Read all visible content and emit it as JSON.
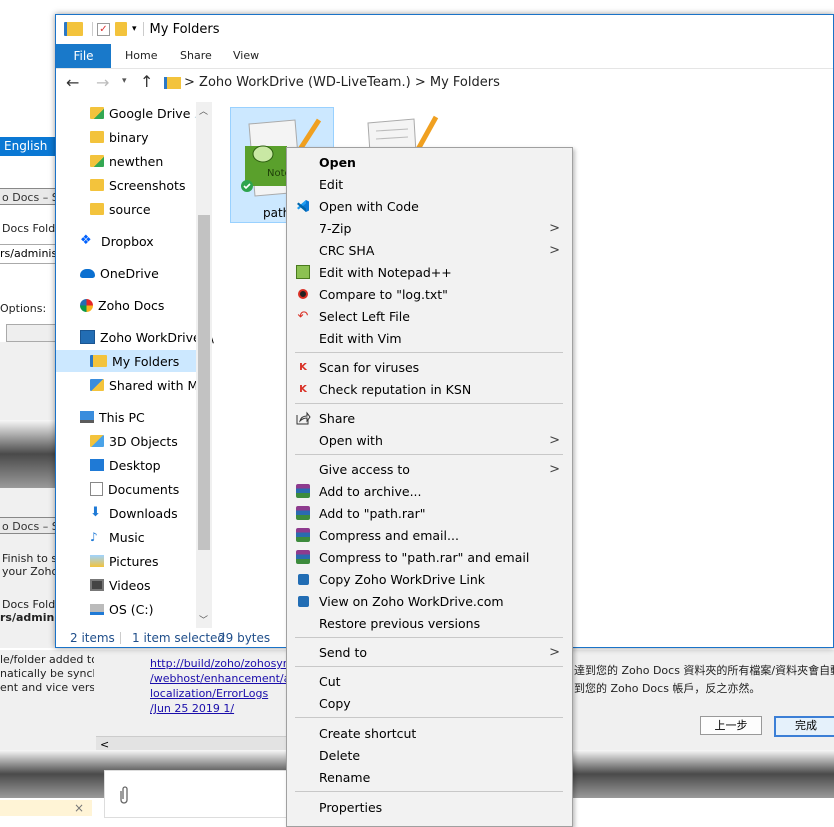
{
  "background": {
    "language_label": "English",
    "titles": [
      "o Docs – Si",
      "o Docs – Si"
    ],
    "folder_labels": [
      "Docs Folde",
      "Docs Folde"
    ],
    "path_values": [
      "rs/adminis",
      "rs/adminis"
    ],
    "options_label": "Options:",
    "finish_text": [
      "Finish to st",
      "your Zoho"
    ],
    "sync_text": [
      "le/folder added to",
      "natically be synchr",
      "ent and vice versa."
    ],
    "log_links": [
      "http://build/zoho/zohosync",
      "/webhost/enhancement/age",
      "localization/ErrorLogs",
      "/Jun 25 2019 1/"
    ],
    "chinese_lines": [
      "達到您的 Zoho Docs 資料夾的所有檔案/資料夾會自動同",
      "到您的 Zoho Docs 帳戶，反之亦然。"
    ],
    "prev_button": "上一步",
    "done_button": "完成",
    "scroll_left": "<",
    "attach_icon": "paperclip-icon",
    "close_glyph": "×"
  },
  "explorer": {
    "title": "My Folders",
    "ribbon_tabs": [
      "File",
      "Home",
      "Share",
      "View"
    ],
    "address": {
      "segments": [
        "Zoho WorkDrive (WD-LiveTeam.)",
        "My Folders"
      ],
      "separator": ">"
    },
    "nav_items": [
      {
        "label": "Google Drive",
        "icon": "google-drive-folder-icon",
        "pinned": true
      },
      {
        "label": "binary",
        "icon": "folder-icon"
      },
      {
        "label": "newthen",
        "icon": "folder-icon"
      },
      {
        "label": "Screenshots",
        "icon": "folder-icon"
      },
      {
        "label": "source",
        "icon": "folder-icon"
      },
      {
        "label": "Dropbox",
        "icon": "dropbox-icon"
      },
      {
        "label": "OneDrive",
        "icon": "onedrive-icon"
      },
      {
        "label": "Zoho Docs",
        "icon": "zoho-docs-icon"
      },
      {
        "label": "Zoho WorkDrive (\\",
        "icon": "zoho-workdrive-icon"
      },
      {
        "label": "My Folders",
        "icon": "my-folders-icon"
      },
      {
        "label": "Shared with Me",
        "icon": "shared-folder-icon"
      },
      {
        "label": "This PC",
        "icon": "this-pc-icon"
      },
      {
        "label": "3D Objects",
        "icon": "3d-objects-icon"
      },
      {
        "label": "Desktop",
        "icon": "desktop-folder-icon"
      },
      {
        "label": "Documents",
        "icon": "documents-folder-icon"
      },
      {
        "label": "Downloads",
        "icon": "downloads-folder-icon"
      },
      {
        "label": "Music",
        "icon": "music-folder-icon"
      },
      {
        "label": "Pictures",
        "icon": "pictures-folder-icon"
      },
      {
        "label": "Videos",
        "icon": "videos-folder-icon"
      },
      {
        "label": "OS (C:)",
        "icon": "drive-icon"
      }
    ],
    "files": [
      {
        "name": "path",
        "icon": "notepad-plus-plus-file-icon",
        "selected": true
      },
      {
        "name": "",
        "icon": "text-file-icon",
        "selected": false
      }
    ],
    "status": {
      "items": "2 items",
      "selected": "1 item selected",
      "size": "29 bytes"
    }
  },
  "context_menu": {
    "items": [
      {
        "label": "Open",
        "bold": true,
        "icon": ""
      },
      {
        "label": "Edit",
        "icon": ""
      },
      {
        "label": "Open with Code",
        "icon": "vscode-icon"
      },
      {
        "label": "7-Zip",
        "icon": "",
        "submenu": true
      },
      {
        "label": "CRC SHA",
        "icon": "",
        "submenu": true
      },
      {
        "label": "Edit with Notepad++",
        "icon": "notepad-plus-plus-icon"
      },
      {
        "label": "Compare to \"log.txt\"",
        "icon": "compare-icon"
      },
      {
        "label": "Select Left File",
        "icon": "undo-arrow-icon"
      },
      {
        "label": "Edit with Vim",
        "icon": ""
      },
      {
        "label": "Scan for viruses",
        "icon": "kaspersky-icon",
        "sep_before": true
      },
      {
        "label": "Check reputation in KSN",
        "icon": "kaspersky-icon"
      },
      {
        "label": "Share",
        "icon": "share-icon",
        "sep_before": true
      },
      {
        "label": "Open with",
        "icon": "",
        "submenu": true
      },
      {
        "label": "Give access to",
        "icon": "",
        "submenu": true,
        "sep_before": true
      },
      {
        "label": "Add to archive...",
        "icon": "winrar-icon"
      },
      {
        "label": "Add to \"path.rar\"",
        "icon": "winrar-icon"
      },
      {
        "label": "Compress and email...",
        "icon": "winrar-icon"
      },
      {
        "label": "Compress to \"path.rar\" and email",
        "icon": "winrar-icon"
      },
      {
        "label": "Copy Zoho WorkDrive Link",
        "icon": "zoho-workdrive-icon"
      },
      {
        "label": "View on Zoho WorkDrive.com",
        "icon": "zoho-workdrive-icon"
      },
      {
        "label": "Restore previous versions",
        "icon": ""
      },
      {
        "label": "Send to",
        "icon": "",
        "submenu": true,
        "sep_before": true
      },
      {
        "label": "Cut",
        "icon": "",
        "sep_before": true
      },
      {
        "label": "Copy",
        "icon": ""
      },
      {
        "label": "Create shortcut",
        "icon": "",
        "sep_before": true
      },
      {
        "label": "Delete",
        "icon": ""
      },
      {
        "label": "Rename",
        "icon": ""
      },
      {
        "label": "Properties",
        "icon": "",
        "sep_before": true
      }
    ]
  },
  "colors": {
    "accent": "#1979ca",
    "selection": "#cce8ff",
    "menu_bg": "#f2f2f2"
  }
}
